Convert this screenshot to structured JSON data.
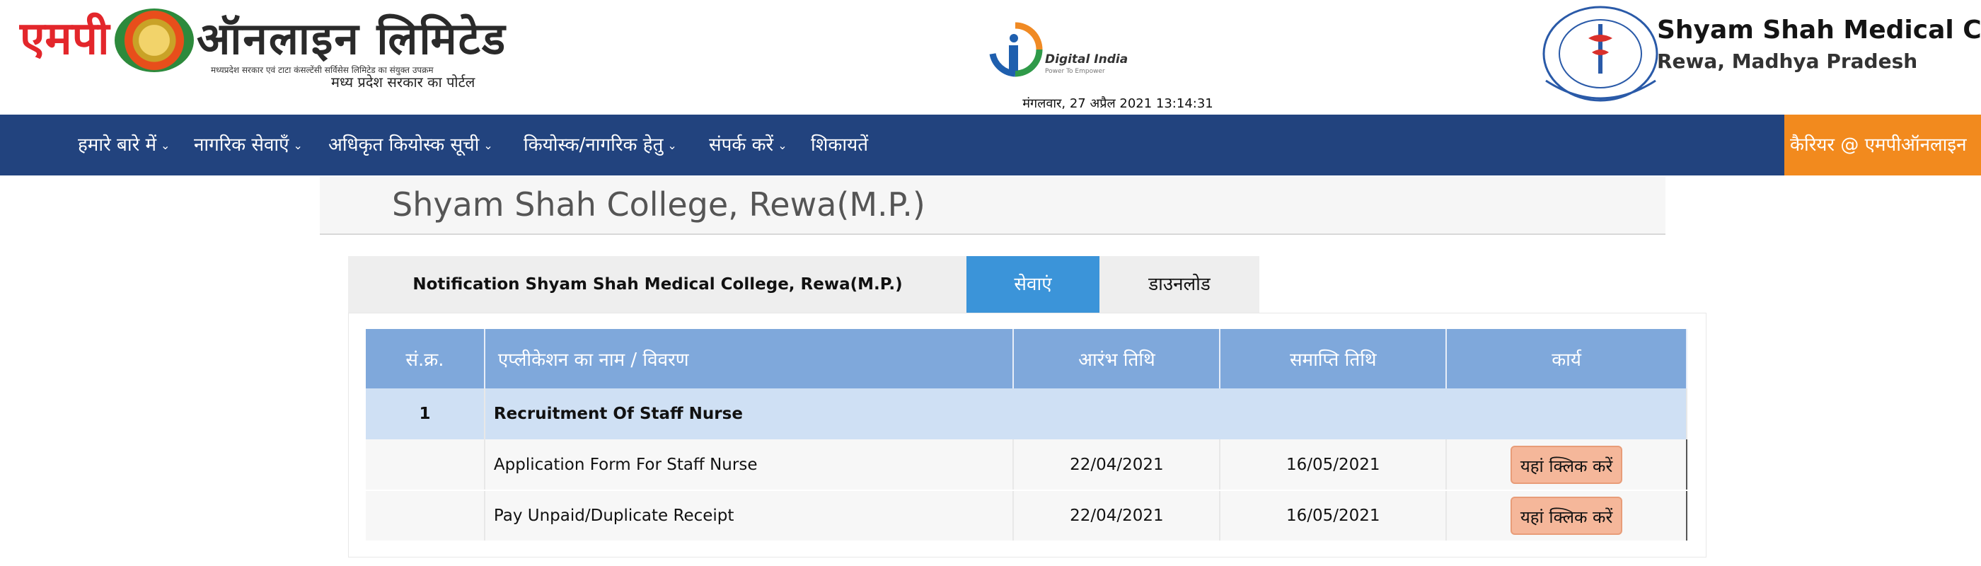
{
  "header": {
    "logo_mp": "एमपी",
    "logo_online": "ऑनलाइन  लिमिटेड",
    "logo_tagline_small": "मध्यप्रदेश सरकार एवं टाटा कंसल्टेंसी सर्विसेस लिमिटेड का संयुक्त उपक्रम",
    "logo_tagline": "मध्य प्रदेश सरकार का पोर्टल",
    "digital_india": "Digital India",
    "digital_india_sub": "Power To Empower",
    "datetime": "मंगलवार, 27 अप्रैल 2021 13:14:31",
    "college_title": "Shyam Shah Medical College",
    "college_subtitle": "Rewa, Madhya Pradesh"
  },
  "nav": {
    "items": [
      {
        "label": "हमारे बारे में"
      },
      {
        "label": "नागरिक सेवाएँ"
      },
      {
        "label": "अधिकृत कियोस्क सूची"
      },
      {
        "label": "कियोस्क/नागरिक हेतु"
      },
      {
        "label": "संपर्क करें"
      },
      {
        "label": "शिकायतें"
      }
    ],
    "career": "कैरियर @ एमपीऑनलाइन"
  },
  "page_title": "Shyam Shah College, Rewa(M.P.)",
  "tabs": {
    "notification": "Notification Shyam Shah Medical College, Rewa(M.P.)",
    "services": "सेवाएं",
    "download": "डाउनलोड"
  },
  "table": {
    "headers": {
      "sno": "सं.क्र.",
      "name": "एप्लीकेशन का नाम / विवरण",
      "start": "आरंभ तिथि",
      "end": "समाप्ति तिथि",
      "action": "कार्य"
    },
    "group": {
      "sno": "1",
      "title": "Recruitment Of Staff Nurse"
    },
    "rows": [
      {
        "name": "Application Form For Staff Nurse",
        "start": "22/04/2021",
        "end": "16/05/2021",
        "action": "यहां क्लिक करें"
      },
      {
        "name": "Pay Unpaid/Duplicate Receipt",
        "start": "22/04/2021",
        "end": "16/05/2021",
        "action": "यहां क्लिक करें"
      }
    ]
  }
}
